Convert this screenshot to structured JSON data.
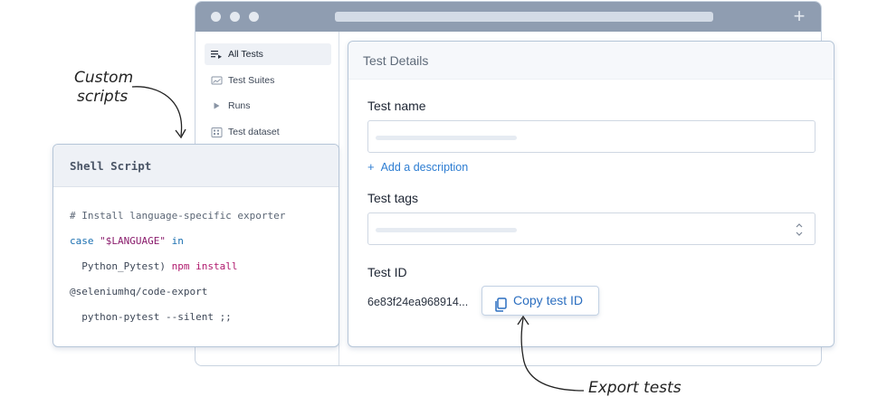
{
  "window": {
    "titlebar_color": "#8f9db1",
    "new_tab_label": "+"
  },
  "sidebar": {
    "items": [
      {
        "label": "All Tests",
        "icon": "list-play-icon",
        "active": true
      },
      {
        "label": "Test Suites",
        "icon": "image-icon",
        "active": false
      },
      {
        "label": "Runs",
        "icon": "play-icon",
        "active": false
      },
      {
        "label": "Test dataset",
        "icon": "grid-icon",
        "active": false
      }
    ]
  },
  "details": {
    "title": "Test Details",
    "test_name_label": "Test name",
    "add_description": "Add a description",
    "test_tags_label": "Test tags",
    "test_id_label": "Test ID",
    "test_id_value": "6e83f24ea968914...",
    "copy_button": "Copy test ID",
    "accent_color": "#2d7dd2"
  },
  "shell": {
    "title": "Shell Script",
    "code": {
      "line1": "# Install language-specific exporter",
      "line2_kw1": "case",
      "line2_str": "\"$LANGUAGE\"",
      "line2_kw2": "in",
      "line3_pre": "  Python_Pytest) ",
      "line3_cmd": "npm install",
      "line4": "@seleniumhq/code-export",
      "line5": "  python-pytest --silent ;;"
    }
  },
  "annotations": {
    "custom_line1": "Custom",
    "custom_line2": "scripts",
    "export": "Export tests"
  }
}
